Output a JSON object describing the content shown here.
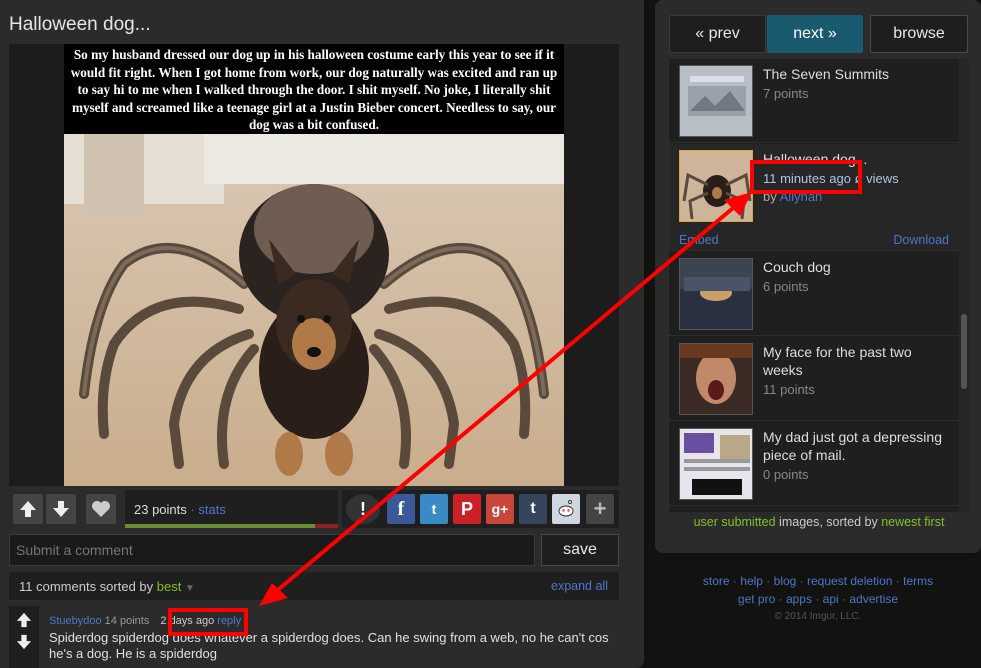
{
  "post": {
    "title": "Halloween dog...",
    "caption": "So my husband dressed our dog up in his halloween costume early this year to see if it would fit right.   When I got home from work, our dog naturally was excited and ran up to say hi to me when I walked through the door.  I shit myself.  No joke, I literally shit myself and screamed like a teenage girl at a Justin Bieber concert.   Needless to say, our dog was a bit confused.",
    "points": "23 points",
    "stats_label": "stats",
    "points_separator": "·"
  },
  "comment_box": {
    "placeholder": "Submit a comment",
    "save_label": "save"
  },
  "comments_header": {
    "count_text": "11 comments sorted by",
    "sort_value": "best",
    "expand_all": "expand all"
  },
  "comment": {
    "user": "Stuebydoo",
    "points": "14 points",
    "time": "2 days ago",
    "reply": "reply",
    "text": "Spiderdog spiderdog does whatever a spiderdog does. Can he swing from a web, no he can't cos he's a dog. He is a spiderdog"
  },
  "nav": {
    "prev": "« prev",
    "next": "next »",
    "browse": "browse"
  },
  "gallery": {
    "items": [
      {
        "title": "The Seven Summits",
        "points": "7 points"
      },
      {
        "title": "Halloween dog...",
        "time": "11 minutes ago",
        "views": "ø views",
        "by": "by",
        "author": "Allynah",
        "embed": "Embed",
        "download": "Download"
      },
      {
        "title": "Couch dog",
        "points": "6 points"
      },
      {
        "title": "My face for the past two weeks",
        "points": "11 points"
      },
      {
        "title": "My dad just got a depressing piece of mail.",
        "points": "0 points"
      }
    ],
    "footer_a": "user submitted",
    "footer_b": "images, sorted by",
    "footer_c": "newest first"
  },
  "footer": {
    "links_row1": [
      "store",
      "help",
      "blog",
      "request deletion",
      "terms"
    ],
    "links_row2": [
      "get pro",
      "apps",
      "api",
      "advertise"
    ],
    "separator": "·",
    "copyright": "© 2014 Imgur, LLC."
  },
  "colors": {
    "accent_blue": "#4e76c9",
    "accent_green": "#85bf25",
    "next_button": "#1a5a6e",
    "annotation_red": "#ff0000"
  },
  "icons": [
    "upvote-icon",
    "downvote-icon",
    "heart-icon",
    "report-icon",
    "facebook-icon",
    "twitter-icon",
    "pinterest-icon",
    "googleplus-icon",
    "tumblr-icon",
    "reddit-icon",
    "plus-icon"
  ]
}
